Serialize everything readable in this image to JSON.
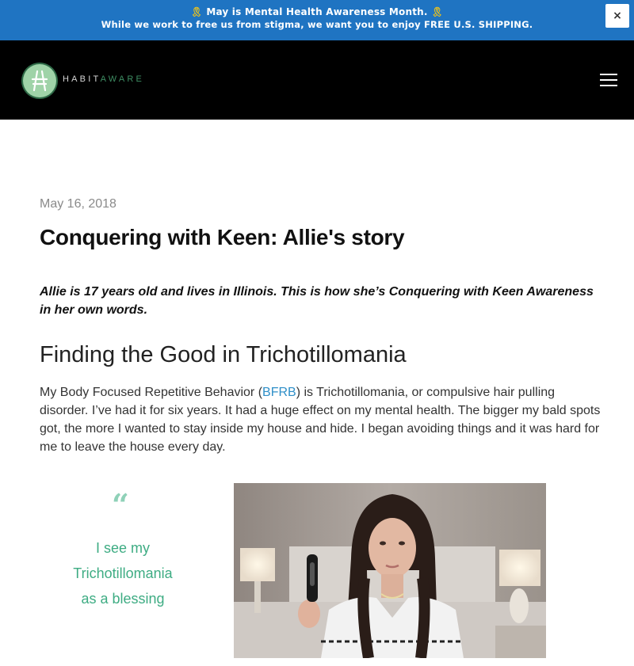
{
  "promo": {
    "line1": "May is Mental Health Awareness Month.",
    "line2": "While we work to free us from stigma, we want you to enjoy FREE U.S. SHIPPING.",
    "ribbon_icon": "awareness-ribbon",
    "close_label": "×"
  },
  "header": {
    "logo_habit": "HABIT",
    "logo_aware": "AWARE",
    "menu_icon": "hamburger-menu"
  },
  "article": {
    "date": "May 16, 2018",
    "title": "Conquering with Keen: Allie's story",
    "intro": "Allie is 17 years old and lives in Illinois. This is how she’s Conquering with Keen Awareness in her own words.",
    "section_heading": "Finding the Good in Trichotillomania",
    "paragraph_before_link": "My Body Focused Repetitive Behavior (",
    "paragraph_link": "BFRB",
    "paragraph_after_link": ") is Trichotillomania, or compulsive hair pulling disorder. I’ve had it for six years. It had a huge effect on my mental health. The bigger my bald spots got, the more I wanted to stay inside my house and hide. I began avoiding things and it was hard for me to leave the house every day.",
    "quote_mark": "“",
    "pull_quote_line1": "I see my",
    "pull_quote_line2": "Trichotillomania",
    "pull_quote_line3": "as a blessing"
  },
  "colors": {
    "banner": "#1f74c2",
    "header": "#000000",
    "logo_aware": "#3e8e63",
    "link": "#2f8fc8",
    "quote": "#3eac83"
  }
}
